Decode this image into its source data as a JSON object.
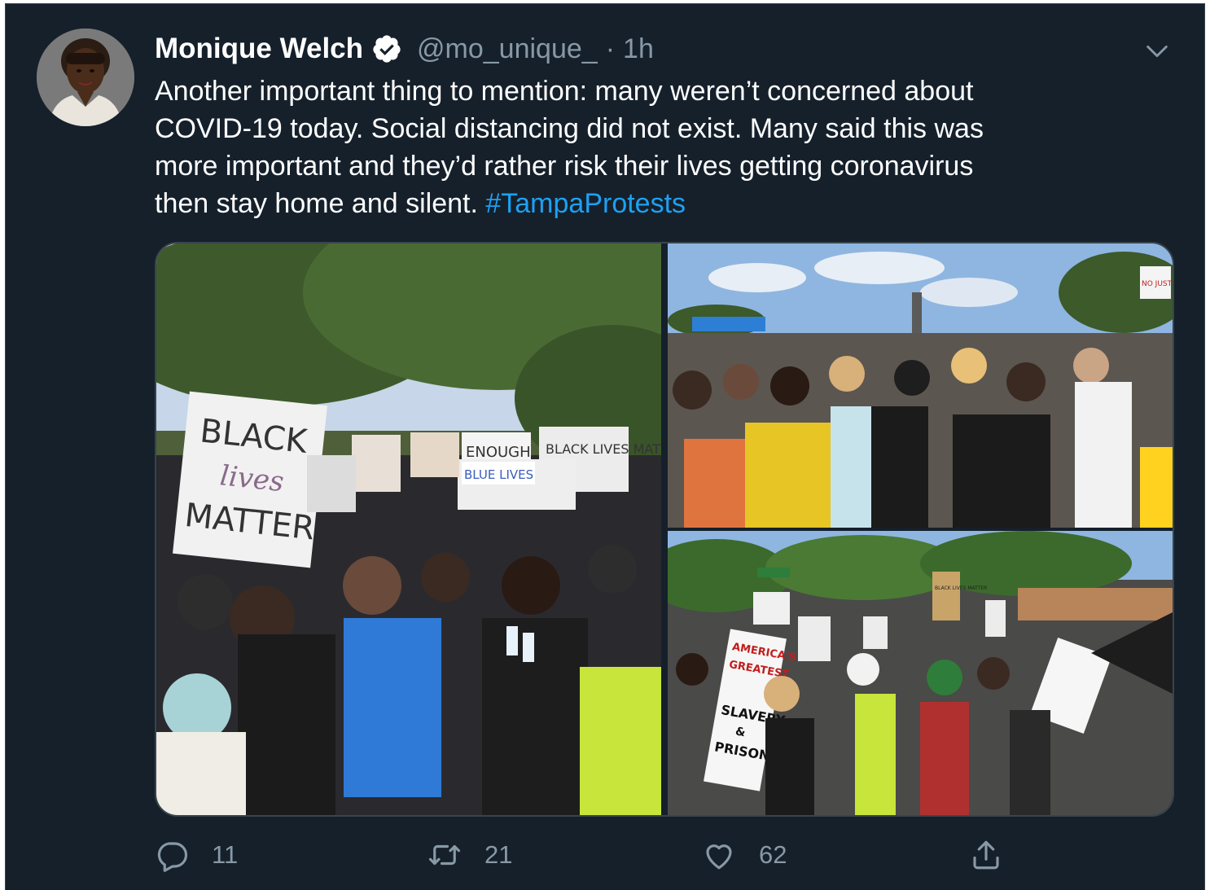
{
  "author": {
    "name": "Monique Welch",
    "handle": "@mo_unique_",
    "separator": "·",
    "time": "1h",
    "verified": true
  },
  "tweet": {
    "lines": [
      "Another important thing to mention: many weren’t concerned about",
      "COVID-19 today. Social distancing did not exist. Many said this was",
      "more important and they’d rather risk their lives getting coronavirus"
    ],
    "last_line_text": "then stay home and silent. ",
    "hashtag": "#TampaProtests"
  },
  "media": {
    "photos": [
      {
        "id": "photo-1",
        "signs": [
          "BLACK",
          "lives",
          "MATTER",
          "ENOUGH",
          "BLUE LIVES",
          "BLACK LIVES MATTER"
        ]
      },
      {
        "id": "photo-2",
        "signs": [
          "NO JUSTICE NO PEACE"
        ]
      },
      {
        "id": "photo-3",
        "signs": [
          "AMERICA'S",
          "GREATEST",
          "SLAVERY",
          "&",
          "PRISONS",
          "BLACK LIVES MATTER"
        ]
      }
    ]
  },
  "actions": {
    "reply_count": "11",
    "retweet_count": "21",
    "like_count": "62"
  },
  "icons": {
    "verified": "verified-badge-icon",
    "caret": "chevron-down-icon",
    "reply": "reply-icon",
    "retweet": "retweet-icon",
    "like": "heart-icon",
    "share": "share-icon"
  },
  "colors": {
    "background": "#15202b",
    "text": "#ffffff",
    "secondary": "#8899a6",
    "link": "#1da1f2",
    "border": "#38444d"
  }
}
